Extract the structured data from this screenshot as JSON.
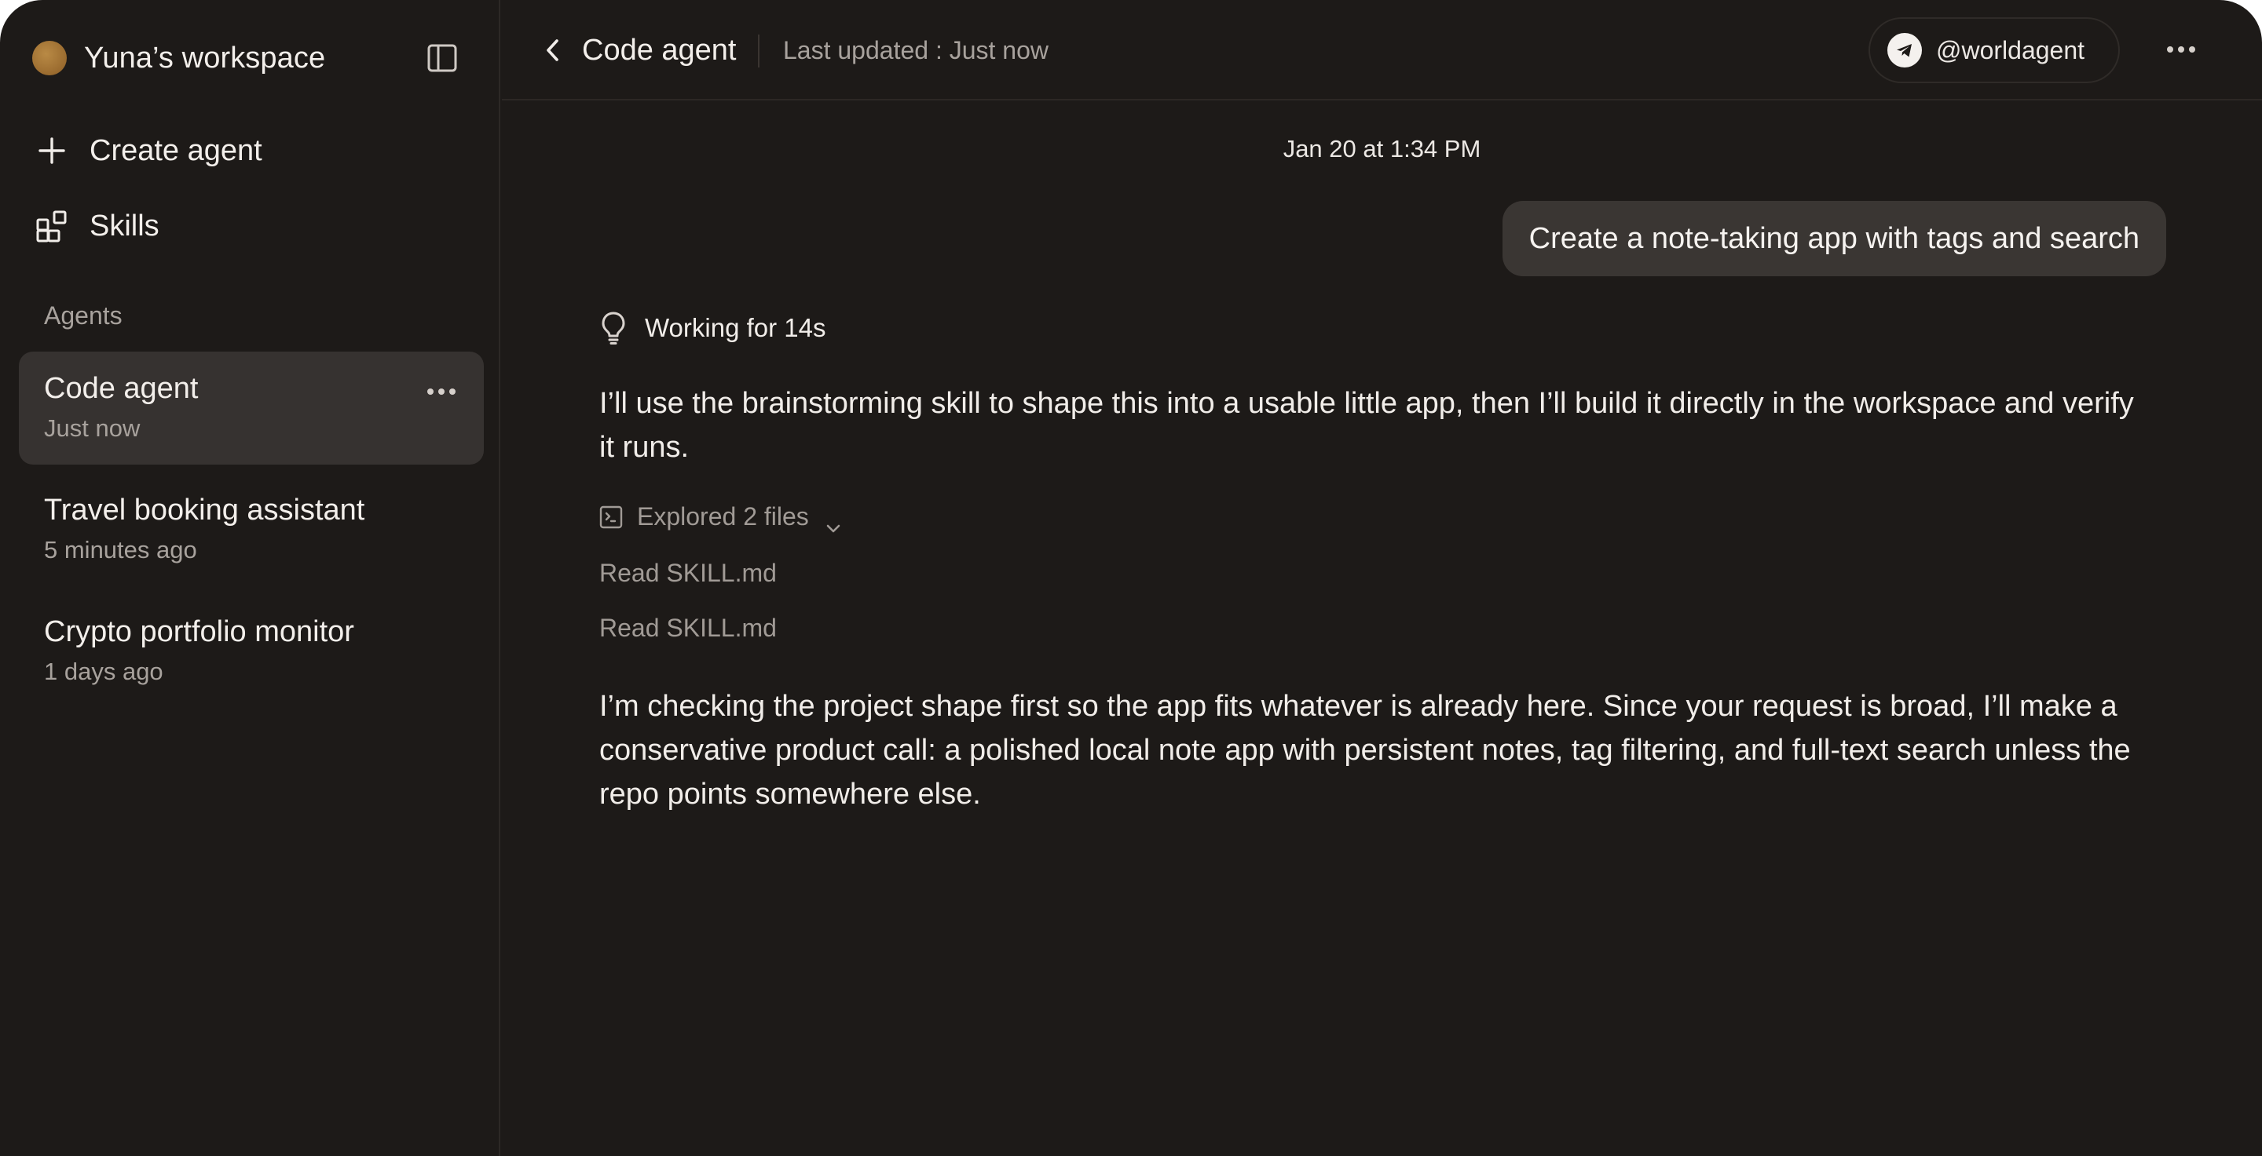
{
  "workspace": {
    "name": "Yuna’s workspace"
  },
  "nav": {
    "create_agent": "Create agent",
    "skills": "Skills"
  },
  "sidebar": {
    "section_label": "Agents",
    "agents": [
      {
        "title": "Code agent",
        "time": "Just now",
        "active": true
      },
      {
        "title": "Travel booking assistant",
        "time": "5 minutes ago",
        "active": false
      },
      {
        "title": "Crypto portfolio monitor",
        "time": "1 days ago",
        "active": false
      }
    ]
  },
  "header": {
    "title": "Code agent",
    "last_updated": "Last updated : Just now",
    "handle": "@worldagent"
  },
  "chat": {
    "date": "Jan 20 at 1:34 PM",
    "user_message": "Create a note-taking app with tags and search",
    "working": "Working for 14s",
    "message_1": "I’ll use the brainstorming skill to shape this into a usable little app, then I’ll build it directly in the workspace and verify it runs.",
    "explored": "Explored 2 files",
    "reads": [
      "Read SKILL.md",
      "Read SKILL.md"
    ],
    "message_2": "I’m checking the project shape first so the app fits whatever is already here. Since your request is broad, I’ll make a conservative product call: a polished local note app with persistent notes, tag filtering, and full-text search unless the repo points somewhere else."
  },
  "colors": {
    "background": "#1d1a18",
    "active_item": "#363230",
    "bubble": "#3a3633",
    "workspace_avatar": "#9a6b2f"
  },
  "icons": {
    "sidebar_toggle": "sidebar-toggle-icon",
    "create": "plus-icon",
    "skills": "grid-blocks-icon",
    "more": "more-horizontal-icon",
    "back": "chevron-left-icon",
    "telegram": "telegram-icon",
    "working": "lightbulb-icon",
    "explored": "terminal-icon",
    "expand": "chevron-down-icon"
  }
}
